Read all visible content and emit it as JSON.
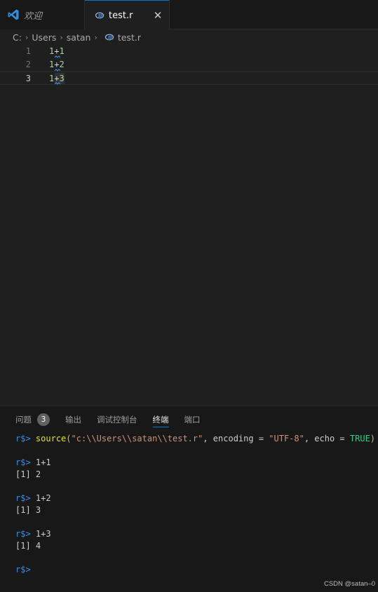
{
  "tabs": {
    "welcome_label": "欢迎",
    "test_label": "test.r",
    "close_glyph": "✕"
  },
  "breadcrumb": {
    "items": [
      "C:",
      "Users",
      "satan",
      "test.r"
    ],
    "separator": "›"
  },
  "editor": {
    "lines": [
      {
        "num": "1",
        "a": "1",
        "op": "+",
        "b": "1"
      },
      {
        "num": "2",
        "a": "1",
        "op": "+",
        "b": "2"
      },
      {
        "num": "3",
        "a": "1",
        "op": "+",
        "b": "3"
      }
    ],
    "current_line": 3
  },
  "panel": {
    "tabs": [
      "问题",
      "输出",
      "调试控制台",
      "终端",
      "端口"
    ],
    "problems_count": "3",
    "active_tab": "终端"
  },
  "terminal": {
    "prompt": "r$>",
    "source_cmd": {
      "fn": "source",
      "open": "(",
      "path": "\"c:\\\\Users\\\\satan\\\\test.r\"",
      "sep1": ", encoding = ",
      "enc": "\"UTF-8\"",
      "sep2": ", echo = ",
      "echo": "TRUE",
      "close": ")"
    },
    "blocks": [
      {
        "cmd": "1+1",
        "out": "[1] 2"
      },
      {
        "cmd": "1+2",
        "out": "[1] 3"
      },
      {
        "cmd": "1+3",
        "out": "[1] 4"
      }
    ]
  },
  "watermark": "CSDN @satan–0",
  "colors": {
    "accent": "#0078d4",
    "prompt": "#3b8eea",
    "number": "#b5cea8"
  }
}
